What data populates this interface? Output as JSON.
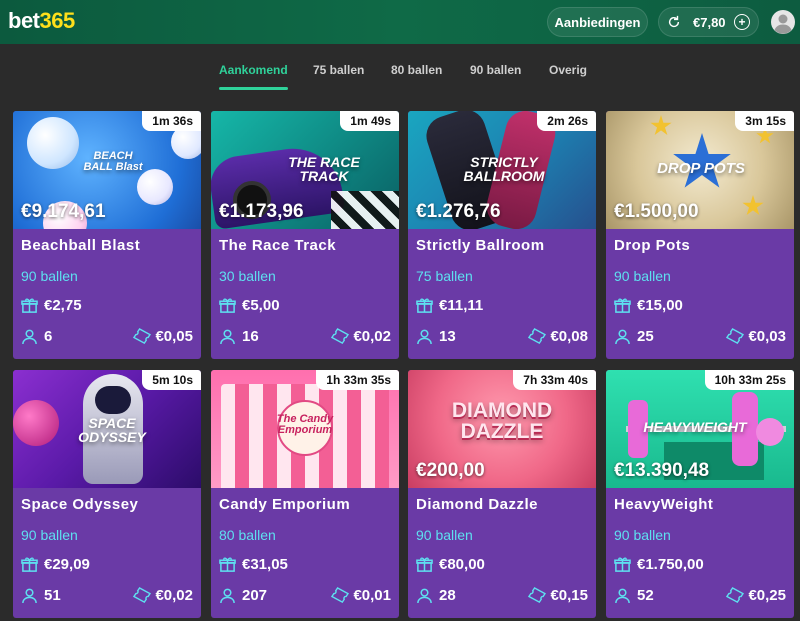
{
  "header": {
    "logo": {
      "part1": "bet",
      "part2": "365"
    },
    "offers_label": "Aanbiedingen",
    "balance": "€7,80"
  },
  "tabs": [
    {
      "label": "Aankomend",
      "active": true
    },
    {
      "label": "75 ballen"
    },
    {
      "label": "80 ballen"
    },
    {
      "label": "90 ballen"
    },
    {
      "label": "Overig"
    }
  ],
  "games": [
    {
      "title": "Beachball Blast",
      "timer": "1m 36s",
      "jackpot": "€9.174,61",
      "balls": "90 ballen",
      "prize": "€2,75",
      "players": "6",
      "cost": "€0,05",
      "art": "BEACH BALL Blast"
    },
    {
      "title": "The Race Track",
      "timer": "1m 49s",
      "jackpot": "€1.173,96",
      "balls": "30 ballen",
      "prize": "€5,00",
      "players": "16",
      "cost": "€0,02",
      "art": "THE RACE TRACK"
    },
    {
      "title": "Strictly Ballroom",
      "timer": "2m 26s",
      "jackpot": "€1.276,76",
      "balls": "75 ballen",
      "prize": "€11,11",
      "players": "13",
      "cost": "€0,08",
      "art": "STRICTLY BALLROOM"
    },
    {
      "title": "Drop Pots",
      "timer": "3m 15s",
      "jackpot": "€1.500,00",
      "balls": "90 ballen",
      "prize": "€15,00",
      "players": "25",
      "cost": "€0,03",
      "art": "DROP POTS"
    },
    {
      "title": "Space Odyssey",
      "timer": "5m 10s",
      "jackpot": "",
      "balls": "90 ballen",
      "prize": "€29,09",
      "players": "51",
      "cost": "€0,02",
      "art": "SPACE ODYSSEY"
    },
    {
      "title": "Candy Emporium",
      "timer": "1h 33m 35s",
      "jackpot": "",
      "balls": "80 ballen",
      "prize": "€31,05",
      "players": "207",
      "cost": "€0,01",
      "art": "The Candy Emporium"
    },
    {
      "title": "Diamond Dazzle",
      "timer": "7h 33m 40s",
      "jackpot": "€200,00",
      "balls": "90 ballen",
      "prize": "€80,00",
      "players": "28",
      "cost": "€0,15",
      "art": "DIAMOND DAZZLE"
    },
    {
      "title": "HeavyWeight",
      "timer": "10h 33m 25s",
      "jackpot": "€13.390,48",
      "balls": "90 ballen",
      "prize": "€1.750,00",
      "players": "52",
      "cost": "€0,25",
      "art": "HEAVYWEIGHT"
    }
  ],
  "colors": {
    "accent": "#2fd29a",
    "card": "#6a3aa6",
    "balls_text": "#5ee0f0",
    "header": "#0f6a47"
  }
}
